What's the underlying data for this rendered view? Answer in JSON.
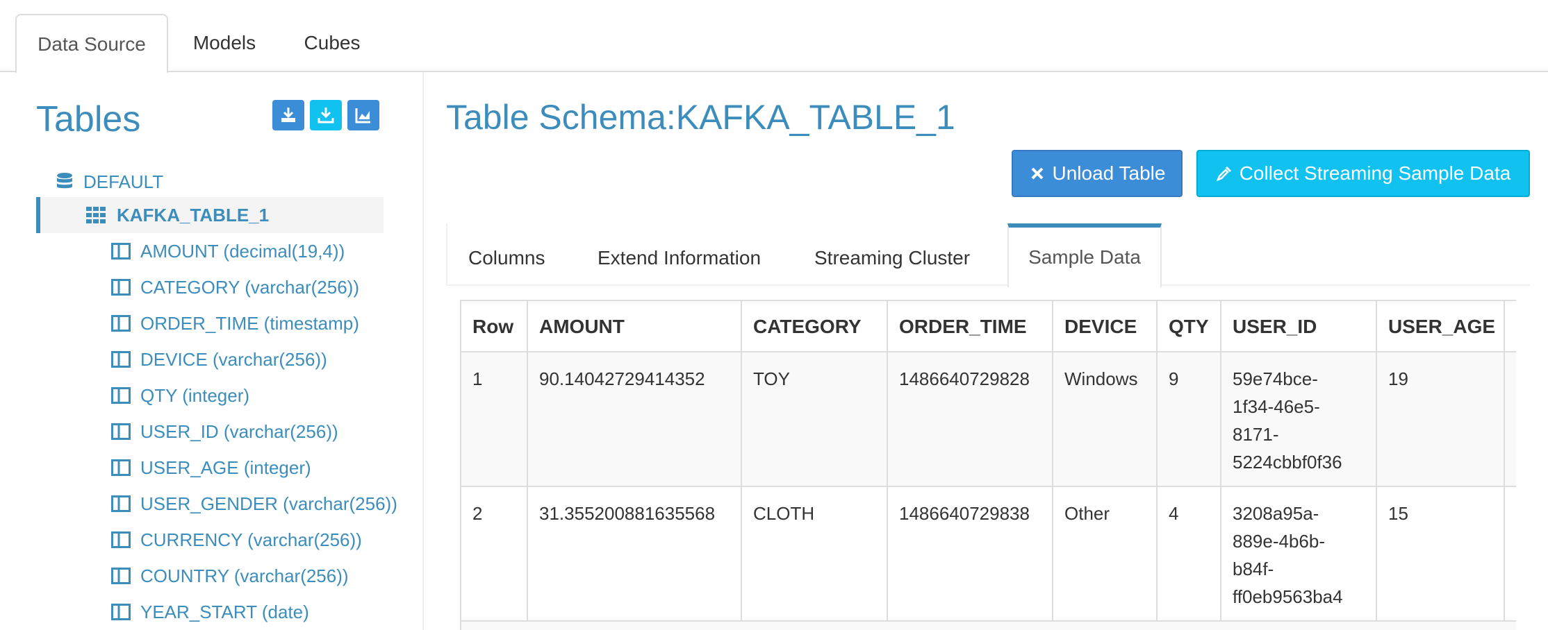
{
  "nav": {
    "tabs": [
      "Data Source",
      "Models",
      "Cubes"
    ],
    "active": "Data Source"
  },
  "sidebar": {
    "title": "Tables",
    "toolbar_icons": [
      "load-table-icon",
      "download-icon",
      "chart-icon"
    ],
    "database": "DEFAULT",
    "selected_table": "KAFKA_TABLE_1",
    "columns": [
      "AMOUNT (decimal(19,4))",
      "CATEGORY (varchar(256))",
      "ORDER_TIME (timestamp)",
      "DEVICE (varchar(256))",
      "QTY (integer)",
      "USER_ID (varchar(256))",
      "USER_AGE (integer)",
      "USER_GENDER (varchar(256))",
      "CURRENCY (varchar(256))",
      "COUNTRY (varchar(256))",
      "YEAR_START (date)"
    ]
  },
  "main": {
    "title": "Table Schema:KAFKA_TABLE_1",
    "unload_label": "Unload Table",
    "collect_label": "Collect Streaming Sample Data",
    "tabs": [
      "Columns",
      "Extend Information",
      "Streaming Cluster",
      "Sample Data"
    ],
    "active_tab": "Sample Data",
    "table": {
      "headers": [
        "Row",
        "AMOUNT",
        "CATEGORY",
        "ORDER_TIME",
        "DEVICE",
        "QTY",
        "USER_ID",
        "USER_AGE"
      ],
      "rows": [
        [
          "1",
          "90.14042729414352",
          "TOY",
          "1486640729828",
          "Windows",
          "9",
          "59e74bce-1f34-46e5-8171-5224cbbf0f36",
          "19"
        ],
        [
          "2",
          "31.355200881635568",
          "CLOTH",
          "1486640729838",
          "Other",
          "4",
          "3208a95a-889e-4b6b-b84f-ff0eb9563ba4",
          "15"
        ]
      ],
      "user_id_lines": [
        [
          "59e74bce-",
          "1f34-46e5-",
          "8171-",
          "5224cbbf0f36"
        ],
        [
          "3208a95a-",
          "889e-4b6b-",
          "b84f-",
          "ff0eb9563ba4"
        ]
      ]
    }
  },
  "colors": {
    "link": "#3c8dbc",
    "primary_button": "#3c8dd8",
    "info_button": "#11c1f0"
  }
}
